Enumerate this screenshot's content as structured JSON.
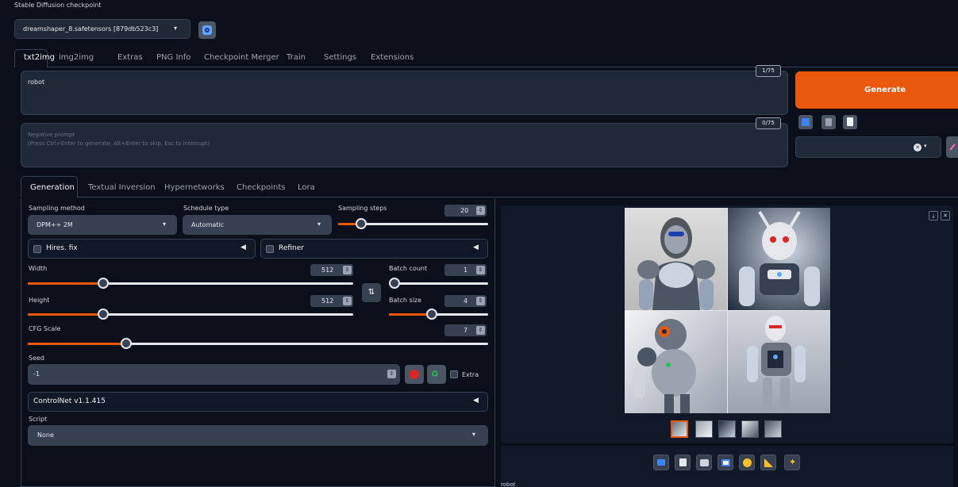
{
  "checkpoint": {
    "label": "Stable Diffusion checkpoint",
    "value": "dreamshaper_8.safetensors [879db523c3]"
  },
  "main_tabs": [
    "txt2img",
    "img2img",
    "Extras",
    "PNG Info",
    "Checkpoint Merger",
    "Train",
    "Settings",
    "Extensions"
  ],
  "prompt": {
    "value": "robot",
    "counter": "1/75"
  },
  "negative_prompt": {
    "placeholder": "Negative prompt\n(Press Ctrl+Enter to generate, Alt+Enter to skip, Esc to interrupt)",
    "counter": "0/75"
  },
  "generate_label": "Generate",
  "sub_tabs": [
    "Generation",
    "Textual Inversion",
    "Hypernetworks",
    "Checkpoints",
    "Lora"
  ],
  "sampling": {
    "method_label": "Sampling method",
    "method_value": "DPM++ 2M",
    "schedule_label": "Schedule type",
    "schedule_value": "Automatic",
    "steps_label": "Sampling steps",
    "steps_value": "20",
    "steps_fraction": 0.2
  },
  "hires_fix": "Hires. fix",
  "refiner": "Refiner",
  "width": {
    "label": "Width",
    "value": "512",
    "fraction": 0.23
  },
  "height": {
    "label": "Height",
    "value": "512",
    "fraction": 0.23
  },
  "batch_count": {
    "label": "Batch count",
    "value": "1",
    "fraction": 0.0
  },
  "batch_size": {
    "label": "Batch size",
    "value": "4",
    "fraction": 0.43
  },
  "cfg": {
    "label": "CFG Scale",
    "value": "7",
    "fraction": 0.21
  },
  "seed": {
    "label": "Seed",
    "value": "-1"
  },
  "extra_label": "Extra",
  "controlnet": "ControlNet v1.1.415",
  "script": {
    "label": "Script",
    "value": "None"
  },
  "output_caption": "robot",
  "colors": {
    "accent": "#ea580c",
    "background": "#0b0f19",
    "panel": "#1f2937",
    "input": "#374151"
  }
}
